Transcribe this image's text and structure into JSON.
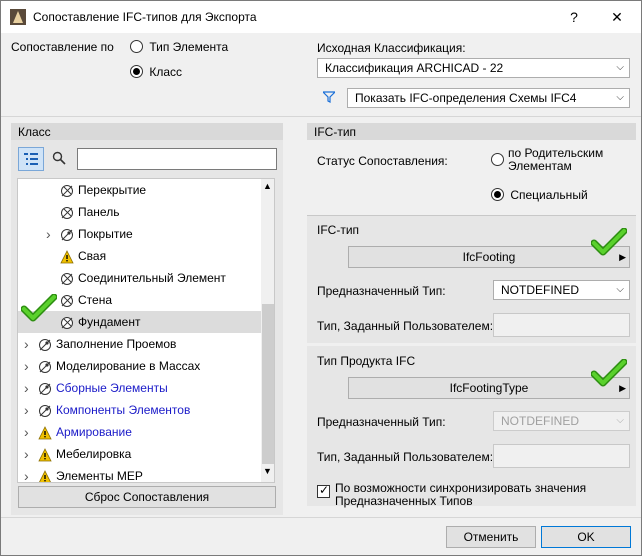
{
  "window": {
    "title": "Сопоставление IFC-типов для Экспорта",
    "help": "?",
    "close": "✕"
  },
  "mapping": {
    "label": "Сопоставление по",
    "option_element_type": "Тип Элемента",
    "option_class": "Класс",
    "selected": "Класс"
  },
  "source": {
    "label": "Исходная Классификация:",
    "classification_value": "Классификация ARCHICAD - 22",
    "filter_value": "Показать IFC-определения Схемы IFC4"
  },
  "left_panel": {
    "header": "Класс",
    "search_placeholder": "",
    "reset_button": "Сброс Сопоставления",
    "tree": [
      {
        "label": "Перекрытие",
        "level": 2,
        "expandable": false,
        "icon": "class-icon",
        "color": "normal",
        "warning": false,
        "selected": false
      },
      {
        "label": "Панель",
        "level": 2,
        "expandable": false,
        "icon": "class-icon",
        "color": "normal",
        "warning": false,
        "selected": false
      },
      {
        "label": "Покрытие",
        "level": 2,
        "expandable": true,
        "icon": "class-custom-icon",
        "color": "normal",
        "warning": false,
        "selected": false
      },
      {
        "label": "Свая",
        "level": 2,
        "expandable": false,
        "icon": "class-warning-icon",
        "color": "normal",
        "warning": true,
        "selected": false
      },
      {
        "label": "Соединительный Элемент",
        "level": 2,
        "expandable": false,
        "icon": "class-icon",
        "color": "normal",
        "warning": false,
        "selected": false
      },
      {
        "label": "Стена",
        "level": 2,
        "expandable": false,
        "icon": "class-icon",
        "color": "normal",
        "warning": false,
        "selected": false
      },
      {
        "label": "Фундамент",
        "level": 2,
        "expandable": false,
        "icon": "class-icon",
        "color": "normal",
        "warning": false,
        "selected": true
      },
      {
        "label": "Заполнение Проемов",
        "level": 1,
        "expandable": true,
        "icon": "class-custom-icon",
        "color": "normal",
        "warning": false,
        "selected": false
      },
      {
        "label": "Моделирование в Массах",
        "level": 1,
        "expandable": true,
        "icon": "class-custom-icon",
        "color": "normal",
        "warning": false,
        "selected": false
      },
      {
        "label": "Сборные Элементы",
        "level": 1,
        "expandable": true,
        "icon": "class-custom-icon",
        "color": "blue",
        "warning": false,
        "selected": false
      },
      {
        "label": "Компоненты Элементов",
        "level": 1,
        "expandable": true,
        "icon": "class-custom-icon",
        "color": "blue",
        "warning": false,
        "selected": false
      },
      {
        "label": "Армирование",
        "level": 1,
        "expandable": true,
        "icon": "class-warning-icon",
        "color": "blue",
        "warning": true,
        "selected": false
      },
      {
        "label": "Мебелировка",
        "level": 1,
        "expandable": true,
        "icon": "class-warning-icon",
        "color": "normal",
        "warning": true,
        "selected": false
      },
      {
        "label": "Элементы MEP",
        "level": 1,
        "expandable": true,
        "icon": "class-warning-icon",
        "color": "normal",
        "warning": true,
        "selected": false
      }
    ]
  },
  "right_panel": {
    "header": "IFC-тип",
    "status_label": "Статус Сопоставления:",
    "status_option_parent": "по Родительским Элементам",
    "status_option_special": "Специальный",
    "status_selected": "Специальный",
    "ifc_type_section": "IFC-тип",
    "ifc_type_value": "IfcFooting",
    "predefined_label": "Предназначенный Тип:",
    "predefined_value": "NOTDEFINED",
    "user_defined_label": "Тип, Заданный Пользователем:",
    "user_defined_value": "",
    "product_section": "Тип Продукта IFC",
    "product_type_value": "IfcFootingType",
    "product_predefined_label": "Предназначенный Тип:",
    "product_predefined_value": "NOTDEFINED",
    "product_user_defined_label": "Тип, Заданный Пользователем:",
    "product_user_defined_value": "",
    "sync_checkbox_label": "По возможности синхронизировать значения Предназначенных Типов",
    "sync_checked": true
  },
  "footer": {
    "cancel": "Отменить",
    "ok": "OK"
  },
  "colors": {
    "accent": "#0078d7",
    "highlight_link": "#1a1ac8",
    "check_green": "#3cb81a",
    "warning": "#f0c000"
  }
}
